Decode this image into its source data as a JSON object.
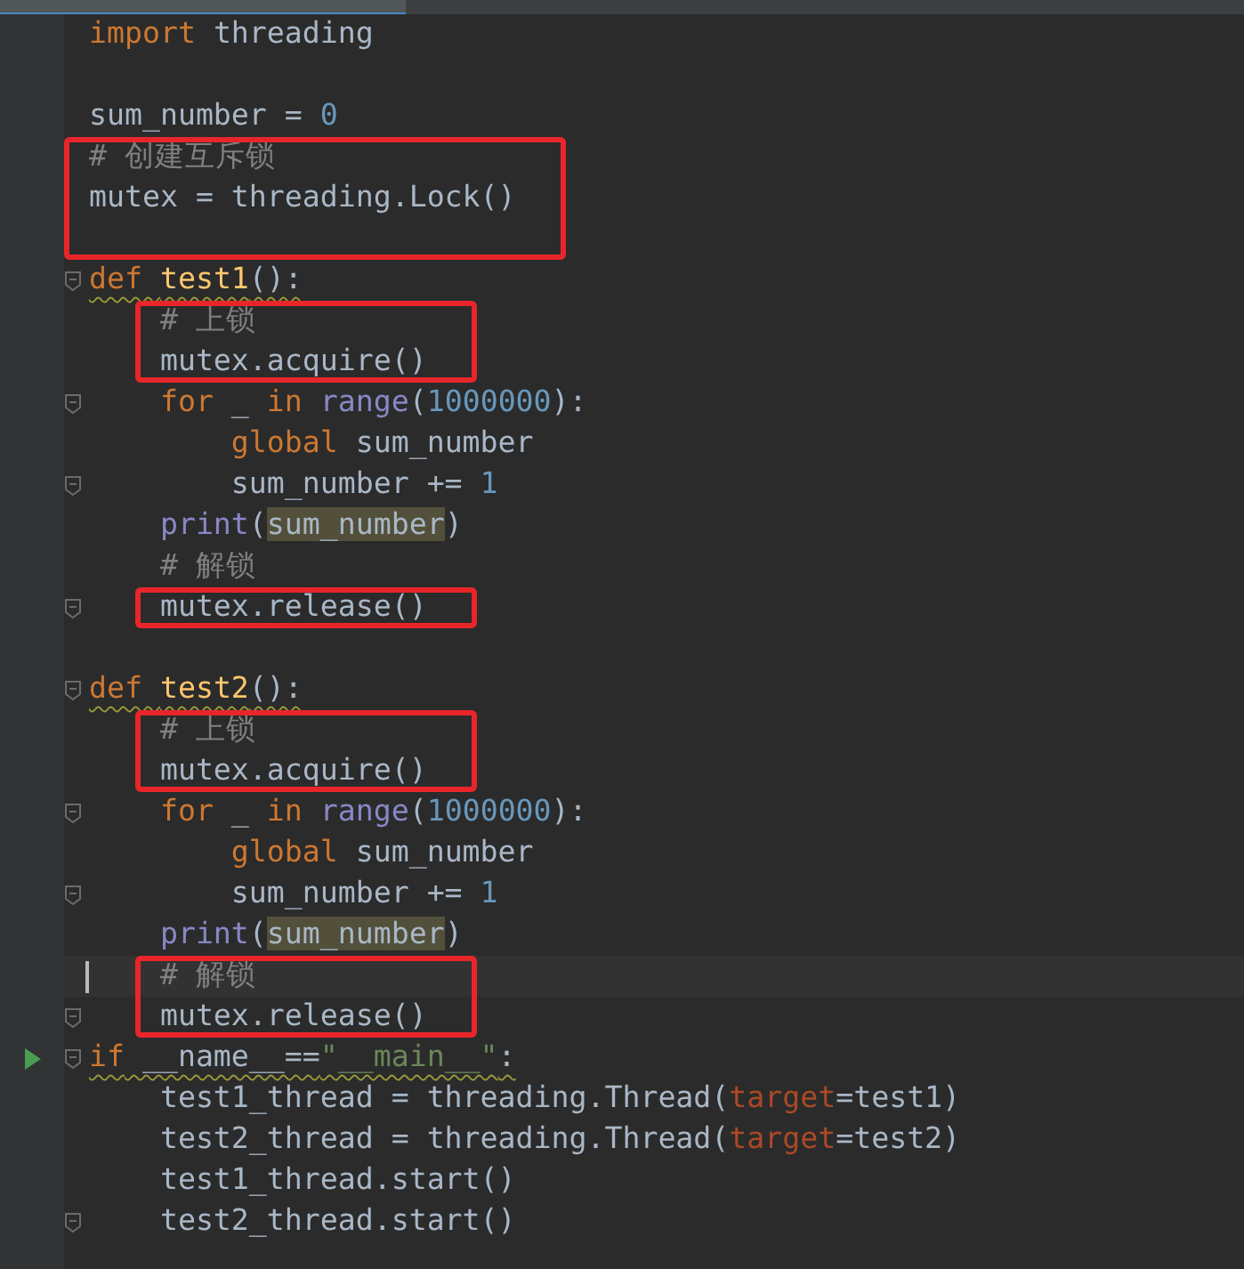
{
  "editor": {
    "blocks": [
      {
        "boxed": false,
        "lines": [
          {
            "current": false,
            "fold": false,
            "run": false,
            "warning": false,
            "tokens": [
              {
                "kind": "keyword",
                "text": "import "
              },
              {
                "kind": "plain",
                "text": "threading"
              }
            ]
          },
          {
            "current": false,
            "fold": false,
            "run": false,
            "warning": false
          },
          {
            "current": false,
            "fold": false,
            "run": false,
            "warning": false,
            "tokens": [
              {
                "kind": "plain",
                "text": "sum_number = "
              },
              {
                "kind": "number",
                "text": "0"
              }
            ]
          }
        ]
      },
      {
        "boxed": true,
        "lines": [
          {
            "current": false,
            "fold": false,
            "run": false,
            "warning": false,
            "tokens": [
              {
                "kind": "comment",
                "text": "# 创建互斥锁"
              }
            ]
          },
          {
            "current": false,
            "fold": false,
            "run": false,
            "warning": false,
            "tokens": [
              {
                "kind": "plain",
                "text": "mutex = threading.Lock()"
              }
            ]
          },
          {
            "current": false,
            "fold": false,
            "run": false,
            "warning": false
          }
        ]
      },
      {
        "boxed": false,
        "lines": [
          {
            "current": false,
            "fold": true,
            "run": false,
            "warning": true,
            "tokens": [
              {
                "kind": "keyword",
                "text": "def "
              },
              {
                "kind": "funcname",
                "text": "test1"
              },
              {
                "kind": "plain",
                "text": "():"
              }
            ]
          }
        ]
      },
      {
        "boxed": true,
        "lines": [
          {
            "current": false,
            "fold": false,
            "run": false,
            "warning": false,
            "tokens": [
              {
                "kind": "comment",
                "text": "    # 上锁"
              }
            ]
          },
          {
            "current": false,
            "fold": false,
            "run": false,
            "warning": false,
            "tokens": [
              {
                "kind": "plain",
                "text": "    mutex.acquire()"
              }
            ]
          }
        ]
      },
      {
        "boxed": false,
        "lines": [
          {
            "current": false,
            "fold": true,
            "run": false,
            "warning": false,
            "tokens": [
              {
                "kind": "keyword",
                "text": "    for"
              },
              {
                "kind": "plain",
                "text": " _ "
              },
              {
                "kind": "keyword",
                "text": "in "
              },
              {
                "kind": "builtin",
                "text": "range"
              },
              {
                "kind": "plain",
                "text": "("
              },
              {
                "kind": "number",
                "text": "1000000"
              },
              {
                "kind": "plain",
                "text": "):"
              }
            ]
          },
          {
            "current": false,
            "fold": false,
            "run": false,
            "warning": false,
            "tokens": [
              {
                "kind": "keyword",
                "text": "        global"
              },
              {
                "kind": "plain",
                "text": " sum_number"
              }
            ]
          },
          {
            "current": false,
            "fold": true,
            "run": false,
            "warning": false,
            "tokens": [
              {
                "kind": "plain",
                "text": "        sum_number += "
              },
              {
                "kind": "number",
                "text": "1"
              }
            ]
          },
          {
            "current": false,
            "fold": false,
            "run": false,
            "warning": false,
            "tokens": [
              {
                "kind": "builtin",
                "text": "    print"
              },
              {
                "kind": "plain",
                "text": "("
              },
              {
                "kind": "highlight",
                "text": "sum_number"
              },
              {
                "kind": "plain",
                "text": ")"
              }
            ]
          },
          {
            "current": false,
            "fold": false,
            "run": false,
            "warning": false,
            "tokens": [
              {
                "kind": "comment",
                "text": "    # 解锁"
              }
            ]
          }
        ]
      },
      {
        "boxed": true,
        "lines": [
          {
            "current": false,
            "fold": true,
            "run": false,
            "warning": false,
            "tokens": [
              {
                "kind": "plain",
                "text": "    mutex.release()"
              }
            ]
          }
        ]
      },
      {
        "boxed": false,
        "lines": [
          {
            "current": false,
            "fold": false,
            "run": false,
            "warning": false
          },
          {
            "current": false,
            "fold": true,
            "run": false,
            "warning": true,
            "tokens": [
              {
                "kind": "keyword",
                "text": "def "
              },
              {
                "kind": "funcname",
                "text": "test2"
              },
              {
                "kind": "plain",
                "text": "():"
              }
            ]
          }
        ]
      },
      {
        "boxed": true,
        "lines": [
          {
            "current": false,
            "fold": false,
            "run": false,
            "warning": false,
            "tokens": [
              {
                "kind": "comment",
                "text": "    # 上锁"
              }
            ]
          },
          {
            "current": false,
            "fold": false,
            "run": false,
            "warning": false,
            "tokens": [
              {
                "kind": "plain",
                "text": "    mutex.acquire()"
              }
            ]
          }
        ]
      },
      {
        "boxed": false,
        "lines": [
          {
            "current": false,
            "fold": true,
            "run": false,
            "warning": false,
            "tokens": [
              {
                "kind": "keyword",
                "text": "    for"
              },
              {
                "kind": "plain",
                "text": " _ "
              },
              {
                "kind": "keyword",
                "text": "in "
              },
              {
                "kind": "builtin",
                "text": "range"
              },
              {
                "kind": "plain",
                "text": "("
              },
              {
                "kind": "number",
                "text": "1000000"
              },
              {
                "kind": "plain",
                "text": "):"
              }
            ]
          },
          {
            "current": false,
            "fold": false,
            "run": false,
            "warning": false,
            "tokens": [
              {
                "kind": "keyword",
                "text": "        global"
              },
              {
                "kind": "plain",
                "text": " sum_number"
              }
            ]
          },
          {
            "current": false,
            "fold": true,
            "run": false,
            "warning": false,
            "tokens": [
              {
                "kind": "plain",
                "text": "        sum_number += "
              },
              {
                "kind": "number",
                "text": "1"
              }
            ]
          },
          {
            "current": false,
            "fold": false,
            "run": false,
            "warning": false,
            "tokens": [
              {
                "kind": "builtin",
                "text": "    print"
              },
              {
                "kind": "plain",
                "text": "("
              },
              {
                "kind": "highlight",
                "text": "sum_number"
              },
              {
                "kind": "plain",
                "text": ")"
              }
            ]
          }
        ]
      },
      {
        "boxed": true,
        "lines": [
          {
            "current": true,
            "fold": false,
            "run": false,
            "warning": false,
            "tokens": [
              {
                "kind": "comment",
                "text": "    # 解锁"
              }
            ]
          },
          {
            "current": false,
            "fold": true,
            "run": false,
            "warning": false,
            "tokens": [
              {
                "kind": "plain",
                "text": "    mutex.release()"
              }
            ]
          }
        ]
      },
      {
        "boxed": false,
        "lines": [
          {
            "current": false,
            "fold": true,
            "run": true,
            "warning": true,
            "tokens": [
              {
                "kind": "keyword",
                "text": "if"
              },
              {
                "kind": "plain",
                "text": " __name__=="
              },
              {
                "kind": "string",
                "text": "\"__main__\""
              },
              {
                "kind": "plain",
                "text": ":"
              }
            ]
          },
          {
            "current": false,
            "fold": false,
            "run": false,
            "warning": false,
            "tokens": [
              {
                "kind": "plain",
                "text": "    test1_thread = threading.Thread("
              },
              {
                "kind": "param",
                "text": "target"
              },
              {
                "kind": "plain",
                "text": "=test1)"
              }
            ]
          },
          {
            "current": false,
            "fold": false,
            "run": false,
            "warning": false,
            "tokens": [
              {
                "kind": "plain",
                "text": "    test2_thread = threading.Thread("
              },
              {
                "kind": "param",
                "text": "target"
              },
              {
                "kind": "plain",
                "text": "=test2)"
              }
            ]
          },
          {
            "current": false,
            "fold": false,
            "run": false,
            "warning": false,
            "tokens": [
              {
                "kind": "plain",
                "text": "    test1_thread.start()"
              }
            ]
          },
          {
            "current": false,
            "fold": true,
            "run": false,
            "warning": false,
            "tokens": [
              {
                "kind": "plain",
                "text": "    test2_thread.start()"
              }
            ]
          }
        ]
      }
    ]
  }
}
